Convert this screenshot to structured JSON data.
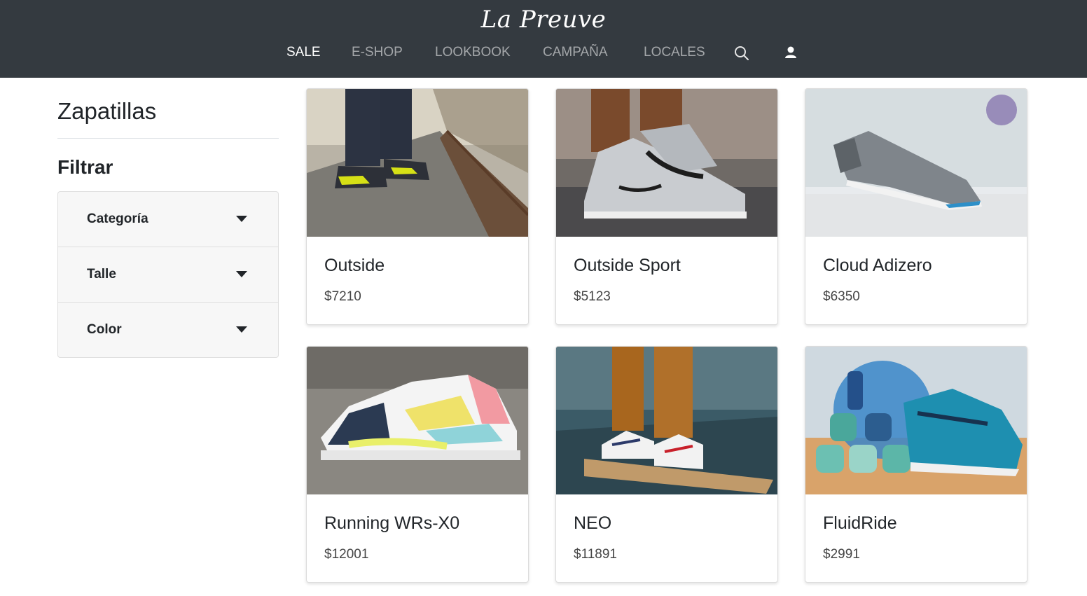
{
  "header": {
    "brand": "La Preuve",
    "nav": [
      {
        "label": "SALE",
        "active": true
      },
      {
        "label": "E-SHOP",
        "active": false
      },
      {
        "label": "LOOKBOOK",
        "active": false
      },
      {
        "label": "CAMPAÑA",
        "active": false
      },
      {
        "label": "LOCALES",
        "active": false
      }
    ],
    "icons": [
      "search-icon",
      "user-icon"
    ]
  },
  "sidebar": {
    "title": "Zapatillas",
    "filter_title": "Filtrar",
    "filters": [
      {
        "label": "Categoría"
      },
      {
        "label": "Talle"
      },
      {
        "label": "Color"
      }
    ]
  },
  "products": [
    {
      "name": "Outside",
      "price": "$7210"
    },
    {
      "name": "Outside Sport",
      "price": "$5123"
    },
    {
      "name": "Cloud Adizero",
      "price": "$6350"
    },
    {
      "name": "Running WRs-X0",
      "price": "$12001"
    },
    {
      "name": "NEO",
      "price": "$11891"
    },
    {
      "name": "FluidRide",
      "price": "$2991"
    }
  ],
  "colors": {
    "header_bg": "#343a40",
    "accordion_bg": "#f7f7f7"
  }
}
